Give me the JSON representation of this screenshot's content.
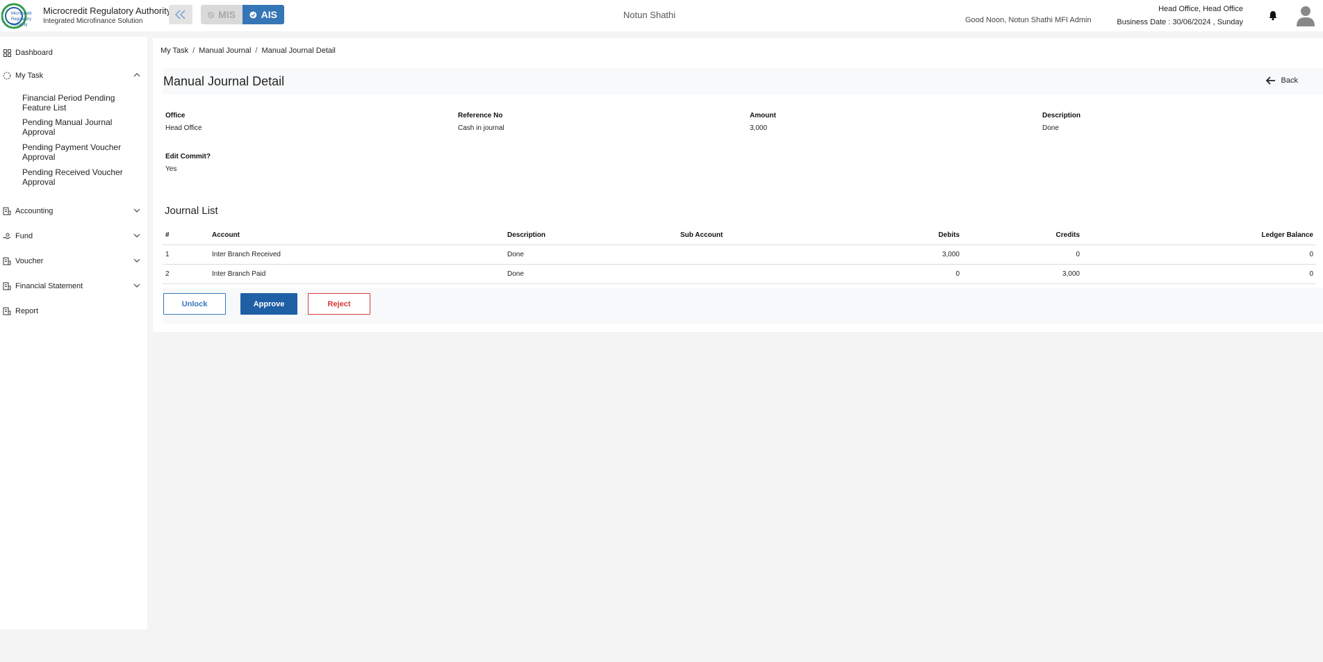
{
  "header": {
    "org_name": "Microcredit Regulatory Authority",
    "org_sub": "Integrated Microfinance Solution",
    "logo_text": [
      "Microcredit",
      "Regulatory",
      "Authority"
    ],
    "modes": {
      "mis": "MIS",
      "ais": "AIS"
    },
    "center_title": "Notun Shathi",
    "greeting": "Good Noon, Notun Shathi MFI Admin",
    "office": "Head Office, Head Office",
    "business_date": "Business Date : 30/06/2024 , Sunday"
  },
  "sidebar": {
    "dashboard": "Dashboard",
    "my_task": "My Task",
    "my_task_items": [
      "Financial Period Pending Feature List",
      "Pending Manual Journal Approval",
      "Pending Payment Voucher Approval",
      "Pending Received Voucher Approval"
    ],
    "accounting": "Accounting",
    "fund": "Fund",
    "voucher": "Voucher",
    "financial_statement": "Financial Statement",
    "report": "Report"
  },
  "breadcrumb": [
    "My Task",
    "Manual Journal",
    "Manual Journal Detail"
  ],
  "detail": {
    "title": "Manual Journal Detail",
    "back": "Back",
    "fields": {
      "office_label": "Office",
      "office_value": "Head Office",
      "ref_label": "Reference No",
      "ref_value": "Cash in journal",
      "amount_label": "Amount",
      "amount_value": "3,000",
      "desc_label": "Description",
      "desc_value": "Done",
      "edit_label": "Edit Commit?",
      "edit_value": "Yes"
    }
  },
  "journal": {
    "title": "Journal List",
    "columns": [
      "#",
      "Account",
      "Description",
      "Sub Account",
      "Debits",
      "Credits",
      "Ledger Balance"
    ],
    "rows": [
      [
        "1",
        "Inter Branch Received",
        "Done",
        "",
        "3,000",
        "0",
        "0"
      ],
      [
        "2",
        "Inter Branch Paid",
        "Done",
        "",
        "0",
        "3,000",
        "0"
      ]
    ]
  },
  "actions": {
    "unlock": "Unlock",
    "approve": "Approve",
    "reject": "Reject"
  },
  "colors": {
    "primary": "#1f5fa6",
    "ais_active": "#3576b6",
    "reject": "#d63a3a",
    "logo_green": "#2e9e4a"
  }
}
